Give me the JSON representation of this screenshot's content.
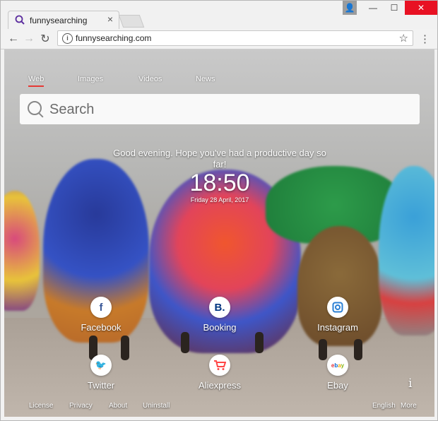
{
  "browser": {
    "tab_title": "funnysearching",
    "url": "funnysearching.com"
  },
  "search": {
    "tabs": [
      "Web",
      "Images",
      "Videos",
      "News"
    ],
    "placeholder": "Search"
  },
  "greeting": "Good evening. Hope you've had a productive day so far!",
  "clock": {
    "time": "18:50",
    "date": "Friday 28 April, 2017"
  },
  "shortcuts": [
    {
      "label": "Facebook",
      "icon": "facebook-icon",
      "glyph": "f",
      "color": "#3b5998"
    },
    {
      "label": "Booking",
      "icon": "booking-icon",
      "glyph": "B.",
      "color": "#003580"
    },
    {
      "label": "Instagram",
      "icon": "instagram-icon",
      "glyph": "◉",
      "color": "#2a7fd4"
    },
    {
      "label": "Twitter",
      "icon": "twitter-icon",
      "glyph": "t",
      "color": "#1da1f2"
    },
    {
      "label": "Aliexpress",
      "icon": "cart-icon",
      "glyph": "🛒",
      "color": "#ff4747"
    },
    {
      "label": "Ebay",
      "icon": "ebay-icon",
      "glyph": "ebay",
      "color": "#e53238"
    }
  ],
  "footer": {
    "left": [
      "License",
      "Privacy",
      "About",
      "Uninstall"
    ],
    "right": [
      "English",
      "More"
    ]
  },
  "colors": {
    "accent": "#e53935",
    "close_button": "#e81123"
  }
}
